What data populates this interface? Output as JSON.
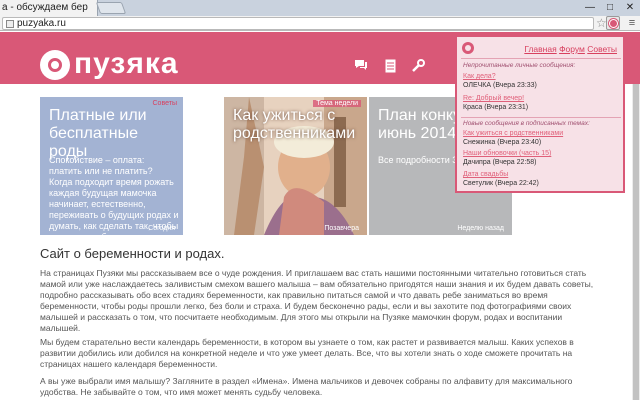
{
  "browser": {
    "tab_title": "а - обсуждаем бер",
    "window_controls": {
      "minimize": "—",
      "maximize": "□",
      "close": "✕"
    },
    "url": "puzyaka.ru",
    "star_icon": "star-icon",
    "menu_icon": "hamburger-menu-icon",
    "extension_icon": "puzyaka-extension-icon"
  },
  "site": {
    "logo_text": "пузяка",
    "header_color": "#d95877",
    "header_icons": [
      "chat-icon",
      "document-icon",
      "wrench-icon"
    ]
  },
  "cards": [
    {
      "tag": "Советы",
      "title": "Платные или бесплатные роды",
      "body": "Спокойствие – оплата: платить или не платить?\nКогда подходит время рожать каждая будущая мамочка начинает, естественно, переживать о будущих родах и думать, как сделать так, чтобы они прошли без",
      "footer": "Сегодня"
    },
    {
      "tag": "Тема недели",
      "title": "Как ужиться с родственниками",
      "footer": "Позавчера"
    },
    {
      "title": "План конку... июнь 2014",
      "body": "Все подробности Здесь",
      "footer": "Неделю назад"
    }
  ],
  "main": {
    "title": "Сайт о беременности и родах.",
    "paragraphs": [
      "На страницах Пузяки мы рассказываем все о чуде рождения. И приглашаем вас стать нашими постоянными читательно готовиться стать мамой или уже наслаждаетесь заливистым смехом вашего малыша – вам обязательно пригодятся наши знания и их будем давать советы, подробно рассказывать обо всех стадиях беременности, как правильно питаться самой и что давать ребе заниматься во время беременности, чтобы роды прошли легко, без боли и страха. И будем бесконечно рады, если и вы захотите под фотографиями своих малышей и рассказать о том, что посчитаете необходимым. Для этого мы открыли на Пузяке мамочкин форум, родах и воспитании малышей.",
      "Мы будем старательно вести календарь беременности, в котором вы узнаете о том, как растет и развивается малыш. Каких успехов в развитии добились или добился на конкретной неделе и что уже умеет делать. Все, что вы хотели знать о ходе сможете прочитать на страницах нашего календаря беременности.",
      "А вы уже выбрали имя малышу? Загляните в раздел «Имена». Имена мальчиков и девочек собраны по алфавиту для максимального удобства. Не забывайте о том, что имя может менять судьбу человека."
    ]
  },
  "popup": {
    "nav": [
      "Главная",
      "Форум",
      "Советы"
    ],
    "section_private": "Непрочитанные личные сообщения:",
    "private_messages": [
      {
        "subject": "Как дела?",
        "author": "ОЛЕЧКА",
        "time": "(Вчера 23:33)"
      },
      {
        "subject": "Re: Добрый вечер!",
        "author": "Краса",
        "time": "(Вчера 23:31)"
      }
    ],
    "section_topics": "Новые сообщения в подписанных темах:",
    "topic_messages": [
      {
        "subject": "Как ужиться с родственниками",
        "author": "Снежинка",
        "time": "(Вчера 23:40)"
      },
      {
        "subject": "Наши обновочки (часть 15)",
        "author": "Дачипра",
        "time": "(Вчера 22:58)"
      },
      {
        "subject": "Дата свадьбы",
        "author": "Светулик",
        "time": "(Вчера 22:42)"
      }
    ]
  }
}
